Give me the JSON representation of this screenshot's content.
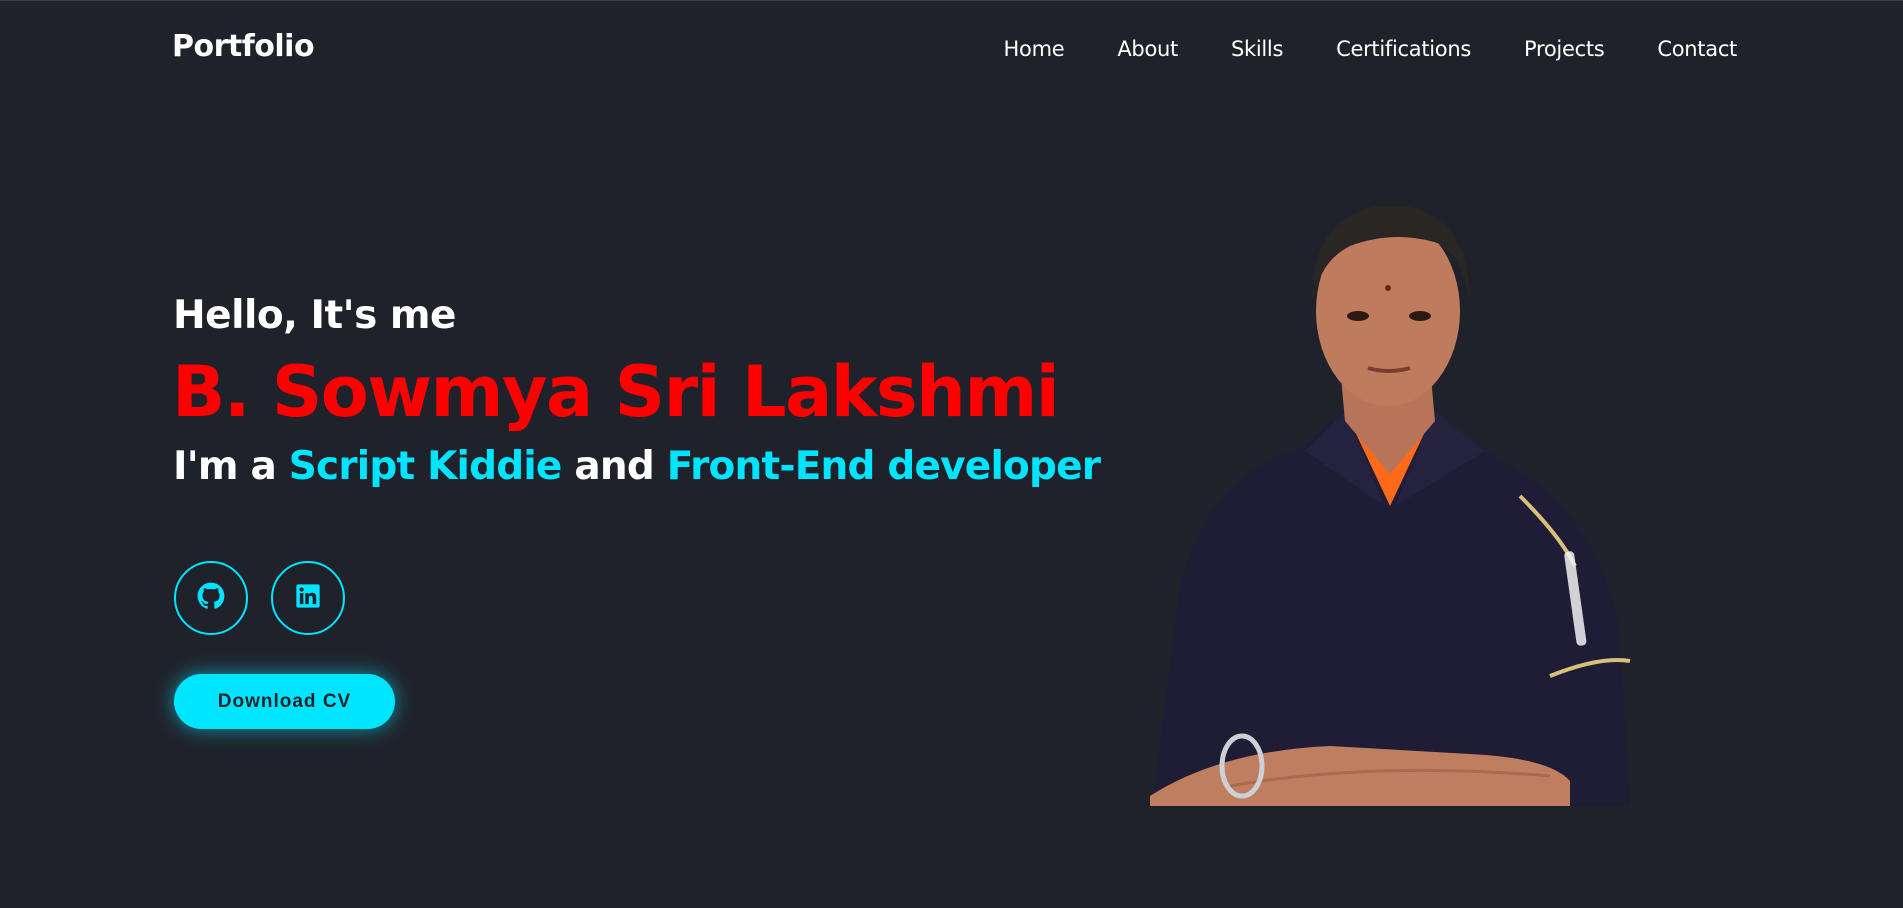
{
  "header": {
    "brand": "Portfolio",
    "nav": [
      "Home",
      "About",
      "Skills",
      "Certifications",
      "Projects",
      "Contact"
    ]
  },
  "hero": {
    "greeting": "Hello, It's me",
    "name": "B. Sowmya Sri Lakshmi",
    "role_prefix": "I'm a",
    "role_1": "Script Kiddie",
    "role_join": "and",
    "role_2": "Front-End developer",
    "cv_button": "Download CV"
  },
  "socials": [
    {
      "icon": "github-icon"
    },
    {
      "icon": "linkedin-icon"
    }
  ],
  "colors": {
    "background": "#1f222b",
    "accent": "#00e5ff",
    "name": "#ff0000",
    "text": "#ffffff"
  }
}
